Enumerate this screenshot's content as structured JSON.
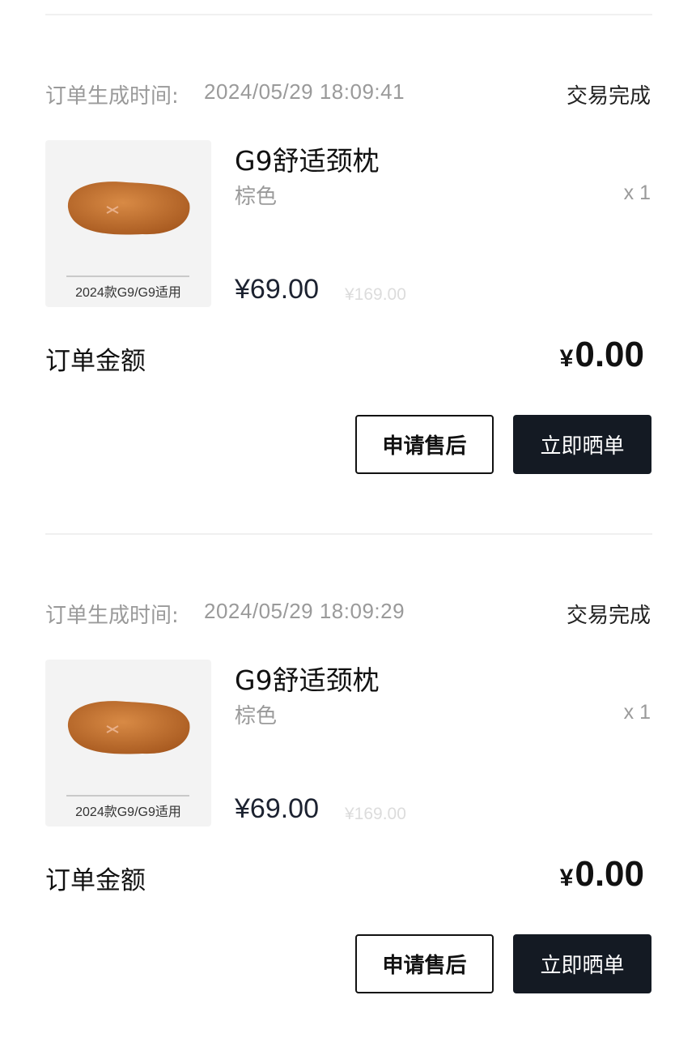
{
  "orders": [
    {
      "created_label": "订单生成时间:",
      "created_time": "2024/05/29 18:09:41",
      "status": "交易完成",
      "product": {
        "name": "G9舒适颈枕",
        "variant": "棕色",
        "quantity": "x 1",
        "price": "¥69.00",
        "original_price": "¥169.00",
        "image_caption": "2024款G9/G9适用",
        "image_icon": "neck-pillow-image"
      },
      "total_label": "订单金额",
      "total_currency": "¥",
      "total_amount": "0.00",
      "after_sales_button": "申请售后",
      "share_button": "立即晒单"
    },
    {
      "created_label": "订单生成时间:",
      "created_time": "2024/05/29 18:09:29",
      "status": "交易完成",
      "product": {
        "name": "G9舒适颈枕",
        "variant": "棕色",
        "quantity": "x 1",
        "price": "¥69.00",
        "original_price": "¥169.00",
        "image_caption": "2024款G9/G9适用",
        "image_icon": "neck-pillow-image"
      },
      "total_label": "订单金额",
      "total_currency": "¥",
      "total_amount": "0.00",
      "after_sales_button": "申请售后",
      "share_button": "立即晒单"
    }
  ],
  "colors": {
    "primary_button_bg": "#141a23",
    "muted_text": "#9a9a9a",
    "pillow": "#c9732f"
  }
}
